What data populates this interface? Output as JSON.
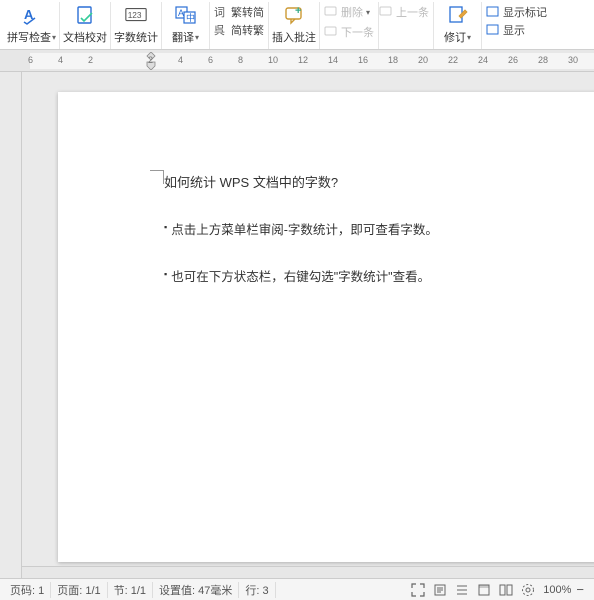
{
  "ribbon": {
    "spellcheck": {
      "label": "拼写检查"
    },
    "docproof": {
      "label": "文档校对"
    },
    "wordcount": {
      "label": "字数统计"
    },
    "translate": {
      "label": "翻译"
    },
    "convert": {
      "trad": "繁转简",
      "simp": "简转繁"
    },
    "insertcomment": {
      "label": "插入批注"
    },
    "comment": {
      "delete": "删除",
      "prev": "上一条",
      "next": "下一条"
    },
    "revise": {
      "label": "修订"
    },
    "show": {
      "markup": "显示标记",
      "all": "显示"
    }
  },
  "ruler": {
    "marks": [
      "6",
      "4",
      "2",
      "",
      "2",
      "4",
      "6",
      "8",
      "10",
      "12",
      "14",
      "16",
      "18",
      "20",
      "22",
      "24",
      "26",
      "28",
      "30"
    ]
  },
  "document": {
    "title": "如何统计 WPS 文档中的字数?",
    "b1": "点击上方菜单栏审阅-字数统计，即可查看字数。",
    "b2": "也可在下方状态栏，右键勾选\"字数统计\"查看。"
  },
  "status": {
    "pageNo": "页码: 1",
    "page": "页面: 1/1",
    "section": "节: 1/1",
    "setval": "设置值: 47毫米",
    "row": "行: 3",
    "zoom": "100%"
  }
}
